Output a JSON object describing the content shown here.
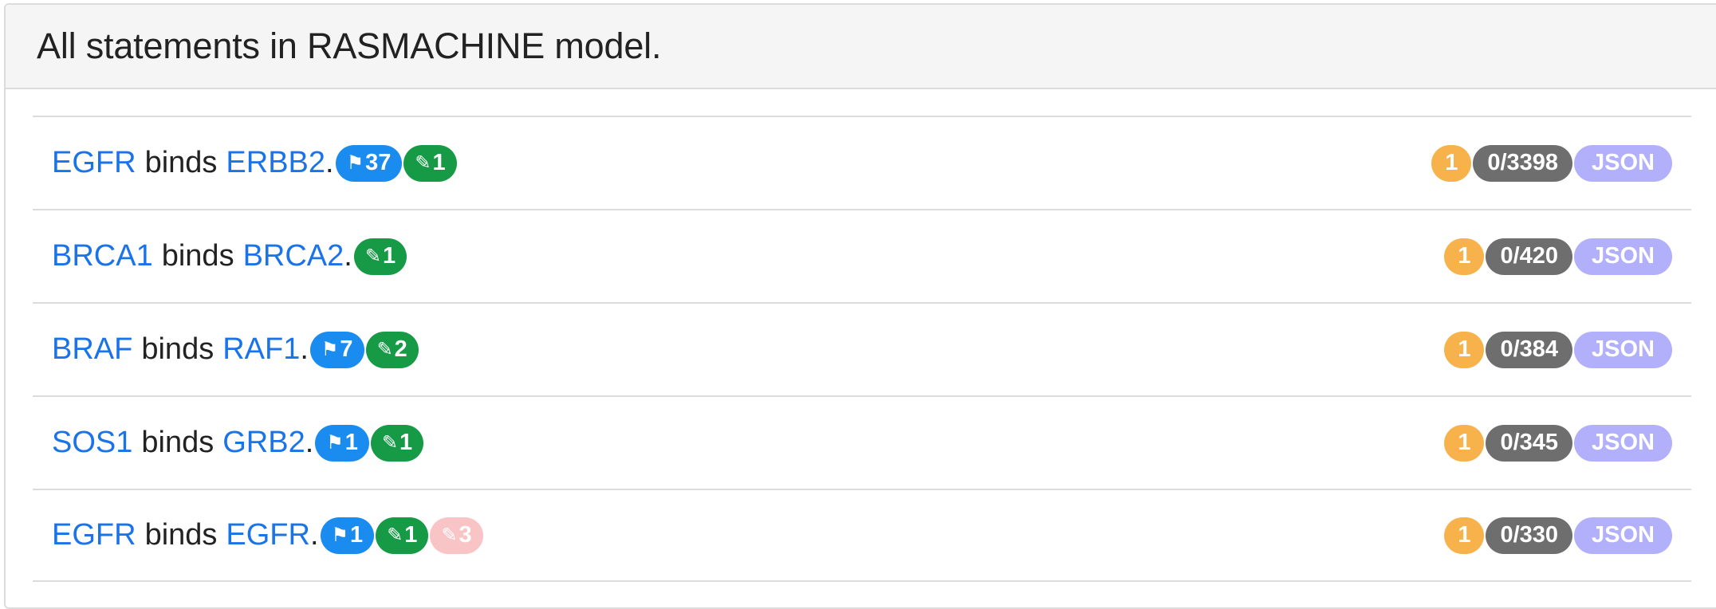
{
  "header": {
    "title": "All statements in RASMACHINE model."
  },
  "colors": {
    "agent_link": "#1a73e8",
    "flag_pill": "#1a8cf0",
    "curation_pill": "#169a45",
    "curation_pill_faded": "#f9c4c6",
    "count_badge": "#f7b24c",
    "ratio_badge": "#6e6e6e",
    "json_badge": "#b3b0fb"
  },
  "icons": {
    "flag": "flag-icon",
    "pencil": "pencil-icon"
  },
  "statements": [
    {
      "subject": "EGFR",
      "verb": "binds",
      "object": "ERBB2",
      "end": ".",
      "flag": "37",
      "edit": "1",
      "edit_faded": null,
      "count": "1",
      "ratio": "0/3398",
      "json": "JSON"
    },
    {
      "subject": "BRCA1",
      "verb": "binds",
      "object": "BRCA2",
      "end": ".",
      "flag": null,
      "edit": "1",
      "edit_faded": null,
      "count": "1",
      "ratio": "0/420",
      "json": "JSON"
    },
    {
      "subject": "BRAF",
      "verb": "binds",
      "object": "RAF1",
      "end": ".",
      "flag": "7",
      "edit": "2",
      "edit_faded": null,
      "count": "1",
      "ratio": "0/384",
      "json": "JSON"
    },
    {
      "subject": "SOS1",
      "verb": "binds",
      "object": "GRB2",
      "end": ".",
      "flag": "1",
      "edit": "1",
      "edit_faded": null,
      "count": "1",
      "ratio": "0/345",
      "json": "JSON"
    },
    {
      "subject": "EGFR",
      "verb": "binds",
      "object": "EGFR",
      "end": ".",
      "flag": "1",
      "edit": "1",
      "edit_faded": "3",
      "count": "1",
      "ratio": "0/330",
      "json": "JSON"
    }
  ]
}
